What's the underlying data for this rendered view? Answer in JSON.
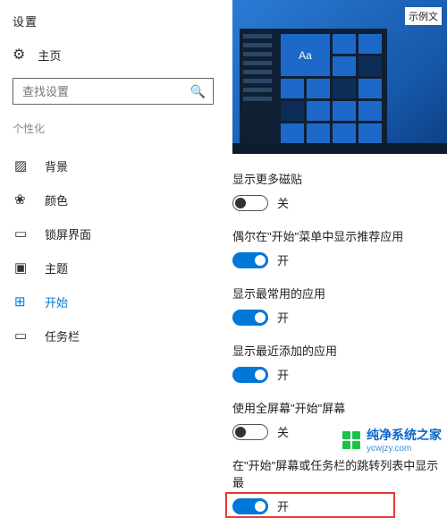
{
  "app_title": "设置",
  "home_label": "主页",
  "search": {
    "placeholder": "查找设置"
  },
  "section_label": "个性化",
  "nav": [
    {
      "id": "background",
      "label": "背景",
      "glyph": "▨"
    },
    {
      "id": "colors",
      "label": "颜色",
      "glyph": "❀"
    },
    {
      "id": "lockscreen",
      "label": "锁屏界面",
      "glyph": "▭"
    },
    {
      "id": "themes",
      "label": "主题",
      "glyph": "▣"
    },
    {
      "id": "start",
      "label": "开始",
      "glyph": "⊞",
      "active": true
    },
    {
      "id": "taskbar",
      "label": "任务栏",
      "glyph": "▭"
    }
  ],
  "preview": {
    "sample_label": "示例文",
    "tile_text": "Aa"
  },
  "settings": [
    {
      "id": "more-tiles",
      "label": "显示更多磁贴",
      "on": false,
      "state": "关"
    },
    {
      "id": "suggested-apps",
      "label": "偶尔在\"开始\"菜单中显示推荐应用",
      "on": true,
      "state": "开"
    },
    {
      "id": "most-used",
      "label": "显示最常用的应用",
      "on": true,
      "state": "开"
    },
    {
      "id": "recently-added",
      "label": "显示最近添加的应用",
      "on": true,
      "state": "开"
    },
    {
      "id": "fullscreen",
      "label": "使用全屏幕\"开始\"屏幕",
      "on": false,
      "state": "关"
    },
    {
      "id": "jump-lists",
      "label": "在\"开始\"屏幕或任务栏的跳转列表中显示最",
      "on": true,
      "state": "开",
      "highlight": true
    }
  ],
  "watermark": {
    "line1": "纯净系统之家",
    "line2": "ycwjzy.com"
  }
}
